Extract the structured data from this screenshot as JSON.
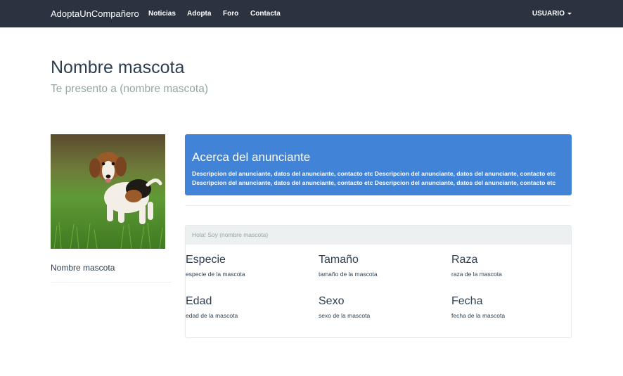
{
  "navbar": {
    "brand": "AdoptaUnCompañero",
    "links": [
      "Noticias",
      "Adopta",
      "Foro",
      "Contacta"
    ],
    "user": "USUARIO"
  },
  "header": {
    "title": "Nombre mascota",
    "subtitle": "Te presento a (nombre mascota)"
  },
  "sidebar": {
    "pet_name": "Nombre mascota"
  },
  "advertiser": {
    "title": "Acerca del anunciante",
    "lines": [
      "Descripcion del anunciante, datos del anunciante, contacto etc Descripcion del anunciante, datos del anunciante, contacto etc",
      "Descripcion del anunciante, datos del anunciante, contacto etc Descripcion del anunciante, datos del anunciante, contacto etc"
    ]
  },
  "info": {
    "heading": "Hola! Soy (nombre mascota)",
    "fields": [
      {
        "label": "Especie",
        "value": "especie de la mascota"
      },
      {
        "label": "Tamaño",
        "value": "tamaño de la mascota"
      },
      {
        "label": "Raza",
        "value": "raza de la mascota"
      },
      {
        "label": "Edad",
        "value": "edad de la mascota"
      },
      {
        "label": "Sexo",
        "value": "sexo de la mascota"
      },
      {
        "label": "Fecha",
        "value": "fecha de la mascota"
      }
    ]
  },
  "colors": {
    "navbar_bg": "#2b3340",
    "panel_blue": "#4183d7",
    "heading_gray": "#ecf0f1",
    "subtitle_gray": "#95a5a6"
  }
}
